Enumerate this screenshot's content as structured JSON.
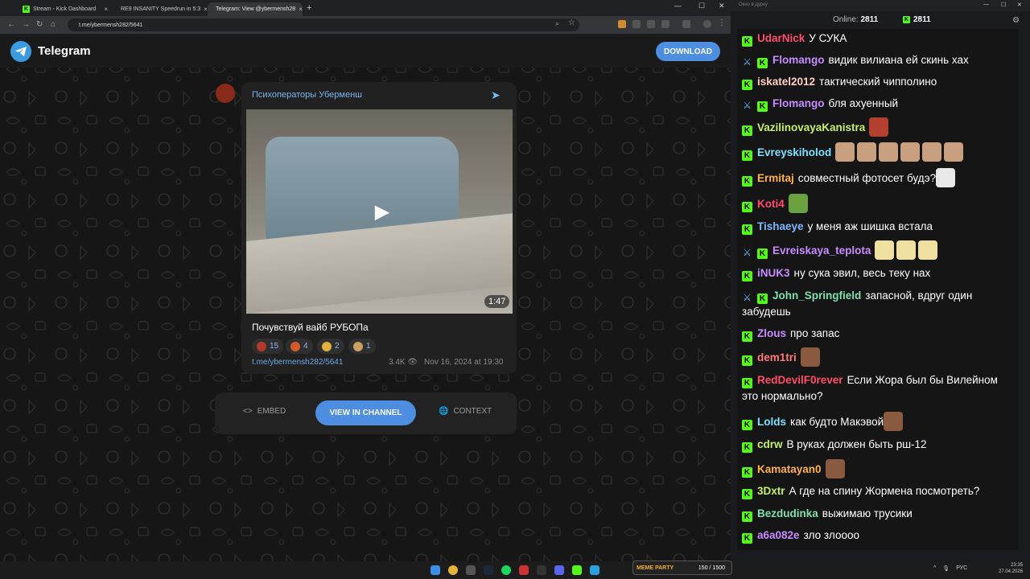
{
  "browser": {
    "tabs": [
      {
        "title": "Stream - Kick Dashboard",
        "icon": "kick-favicon"
      },
      {
        "title": "RE9 INSANITY Speedrun in 5:3",
        "icon": "youtube-favicon"
      },
      {
        "title": "Telegram: View @ybermensh28",
        "icon": "telegram-favicon"
      }
    ],
    "url": "t.me/ybermensh282/5641"
  },
  "telegram": {
    "brand": "Telegram",
    "download_label": "DOWNLOAD",
    "channel_name": "Психоператоры Уберменш",
    "video_duration": "1:47",
    "caption": "Почувствуй вайб РУБОПа",
    "reactions": [
      {
        "count": "15",
        "color": "#b33a2a"
      },
      {
        "count": "4",
        "color": "#d45a2a"
      },
      {
        "count": "2",
        "color": "#e0b040"
      },
      {
        "count": "1",
        "color": "#c9a060"
      }
    ],
    "post_link": "t.me/ybermensh282/5641",
    "views": "3.4K",
    "date": "Nov 16, 2024 at 19:30",
    "embed_label": "EMBED",
    "view_channel_label": "VIEW IN CHANNEL",
    "context_label": "CONTEXT"
  },
  "chat": {
    "window_title": "Окно в дурку",
    "online_label": "Online:",
    "online_count": "2811",
    "k_count": "2811",
    "messages": [
      {
        "user": "UdarNick",
        "color": "#ff4d6a",
        "text": "У СУКА",
        "sword": false,
        "emotes": []
      },
      {
        "user": "Flomango",
        "color": "#c78cff",
        "text": "видик вилиана ей скинь хах",
        "sword": true,
        "emotes": []
      },
      {
        "user": "iskatel2012",
        "color": "#ffd0c0",
        "text": "тактический чипполино",
        "sword": false,
        "emotes": []
      },
      {
        "user": "Flomango",
        "color": "#c78cff",
        "text": "бля ахуенный",
        "sword": true,
        "emotes": []
      },
      {
        "user": "VazilinovayaKanistra",
        "color": "#c5f06a",
        "text": "",
        "sword": false,
        "emotes": [
          "#b3402e"
        ]
      },
      {
        "user": "Evreyskiholod",
        "color": "#7fe0ff",
        "text": "",
        "sword": false,
        "emotes": [
          "#c8a080",
          "#c8a080",
          "#c8a080",
          "#c8a080",
          "#c8a080",
          "#c8a080"
        ]
      },
      {
        "user": "Ermitaj",
        "color": "#ffb14d",
        "text": "совместный фотосет будэ?",
        "sword": false,
        "emotes": [
          "#e8e8e8"
        ]
      },
      {
        "user": "Koti4",
        "color": "#ff4d6a",
        "text": "",
        "sword": false,
        "emotes": [
          "#6aa040"
        ]
      },
      {
        "user": "Tishaeye",
        "color": "#7fb8ff",
        "text": "у меня аж шишка встала",
        "sword": false,
        "emotes": []
      },
      {
        "user": "Evreiskaya_teplota",
        "color": "#c78cff",
        "text": "",
        "sword": true,
        "emotes": [
          "#f0e0a0",
          "#f0e0a0",
          "#f0e0a0"
        ]
      },
      {
        "user": "iNUK3",
        "color": "#c78cff",
        "text": "ну сука эвил, весь теку нах",
        "sword": false,
        "emotes": []
      },
      {
        "user": "John_Springfield",
        "color": "#7fe0b0",
        "text": "запасной, вдруг один забудешь",
        "sword": true,
        "emotes": []
      },
      {
        "user": "Zlous",
        "color": "#c78cff",
        "text": "про запас",
        "sword": false,
        "emotes": []
      },
      {
        "user": "dem1tri",
        "color": "#ff7a7a",
        "text": "",
        "sword": false,
        "emotes": [
          "#8a5a40"
        ]
      },
      {
        "user": "RedDevilF0rever",
        "color": "#ff4d6a",
        "text": "Если Жора был бы Вилейном это нормально?",
        "sword": false,
        "emotes": []
      },
      {
        "user": "Lolds",
        "color": "#7fe0ff",
        "text": "как будто Макэвой",
        "sword": false,
        "emotes": [
          "#8a5a40"
        ]
      },
      {
        "user": "cdrw",
        "color": "#c5f06a",
        "text": "В руках должен быть рш-12",
        "sword": false,
        "emotes": []
      },
      {
        "user": "Kamatayan0",
        "color": "#ffb14d",
        "text": "",
        "sword": false,
        "emotes": [
          "#8a5a40"
        ]
      },
      {
        "user": "3Dxtr",
        "color": "#c5f06a",
        "text": "А где на спину Жормена посмотреть?",
        "sword": false,
        "emotes": []
      },
      {
        "user": "Bezdudinka",
        "color": "#7fe0b0",
        "text": "выжимаю трусики",
        "sword": false,
        "emotes": []
      },
      {
        "user": "a6a082e",
        "color": "#c78cff",
        "text": "зло злоооо",
        "sword": false,
        "emotes": []
      }
    ]
  },
  "taskbar": {
    "widget_label": "MEME PARTY",
    "widget_value": "150 / 1500",
    "lang": "РУС",
    "time": "23:35",
    "date": "27.04.2026"
  }
}
